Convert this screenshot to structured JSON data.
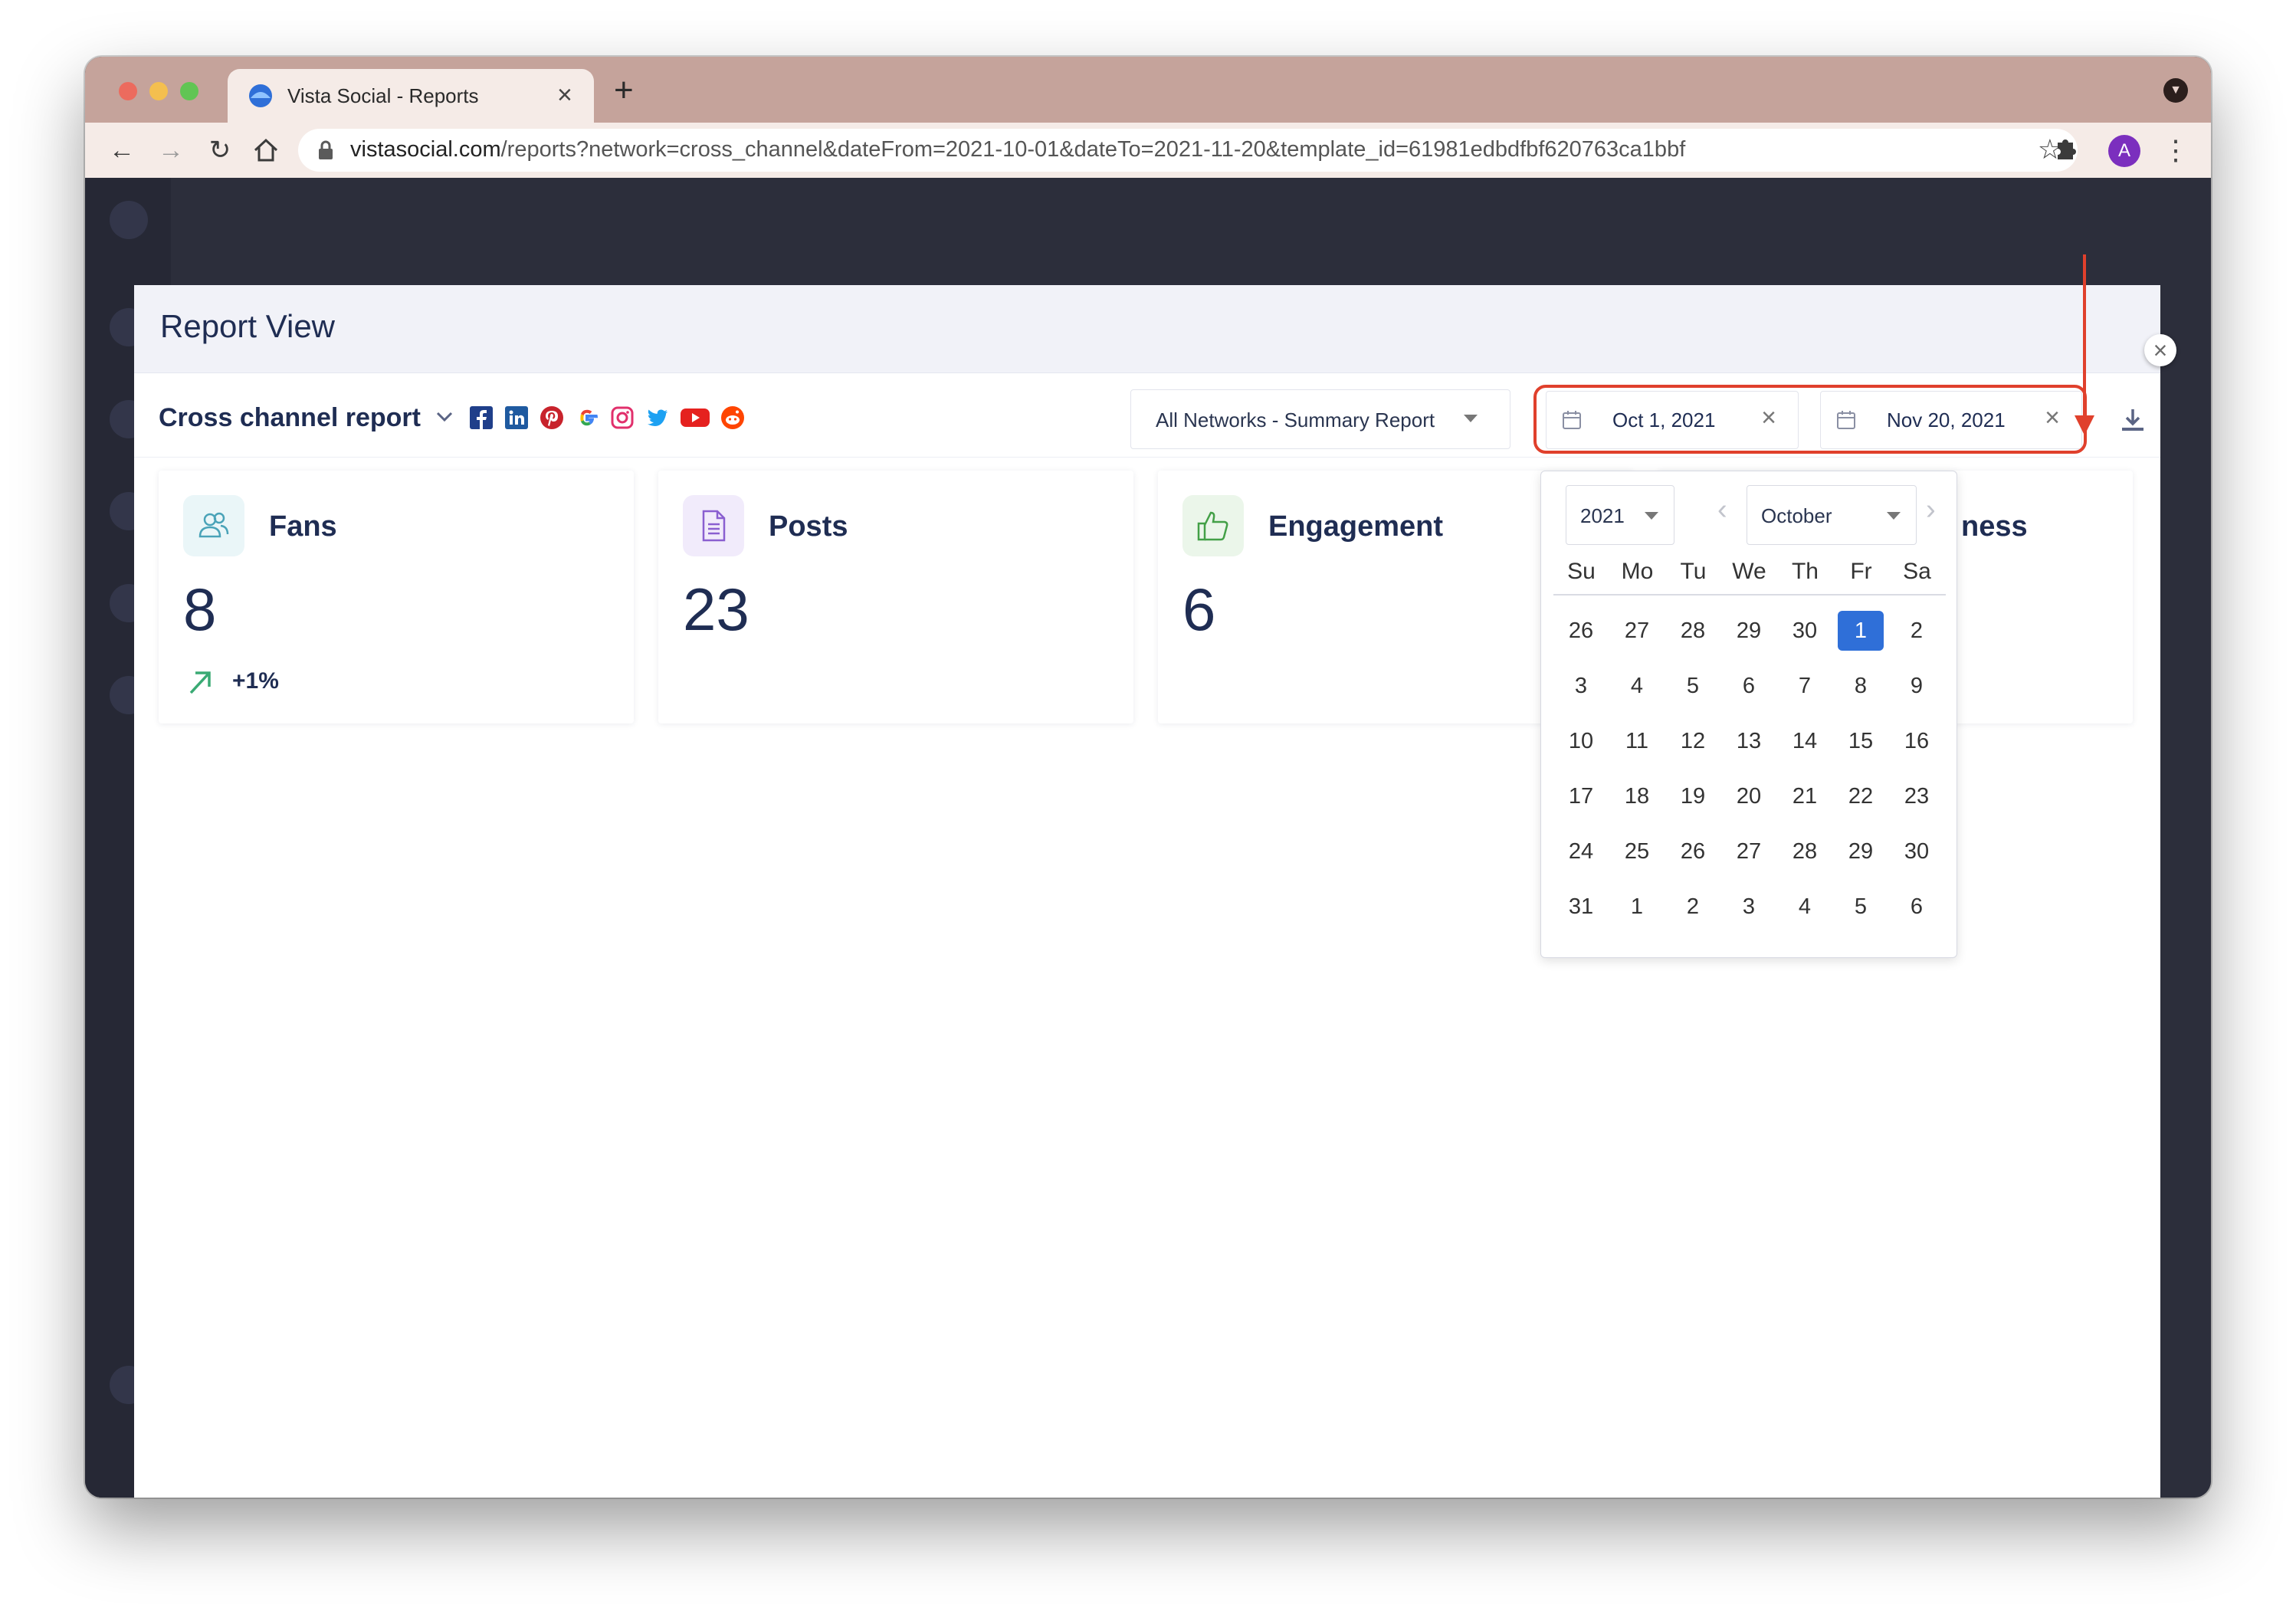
{
  "browser": {
    "tab_title": "Vista Social - Reports",
    "tab_close": "×",
    "new_tab": "+",
    "url_host": "vistasocial.com",
    "url_path": "/reports?network=cross_channel&dateFrom=2021-10-01&dateTo=2021-11-20&template_id=61981edbdfbf620763ca1bbf",
    "profile_initial": "A"
  },
  "modal": {
    "title": "Report View",
    "close": "×"
  },
  "report": {
    "name": "Cross channel report",
    "networks": [
      "facebook-icon",
      "linkedin-icon",
      "pinterest-icon",
      "google-icon",
      "instagram-icon",
      "twitter-icon",
      "youtube-icon",
      "reddit-icon"
    ],
    "network_select": "All Networks - Summary Report",
    "date_from": "Oct 1, 2021",
    "date_to": "Nov 20, 2021",
    "clear": "×"
  },
  "cards": [
    {
      "title": "Fans",
      "value": "8",
      "change": "+1%",
      "icon": "users-icon",
      "icon_color": "#4aa3b8"
    },
    {
      "title": "Posts",
      "value": "23",
      "icon": "document-icon",
      "icon_color": "#8a5fd0"
    },
    {
      "title": "Engagement",
      "value": "6",
      "icon": "thumbs-up-icon",
      "icon_color": "#43a047"
    },
    {
      "title_visible_fragment": "ness"
    }
  ],
  "calendar": {
    "year": "2021",
    "month": "October",
    "prev": "‹",
    "next": "›",
    "weekdays": [
      "Su",
      "Mo",
      "Tu",
      "We",
      "Th",
      "Fr",
      "Sa"
    ],
    "weeks": [
      [
        "26",
        "27",
        "28",
        "29",
        "30",
        "1",
        "2"
      ],
      [
        "3",
        "4",
        "5",
        "6",
        "7",
        "8",
        "9"
      ],
      [
        "10",
        "11",
        "12",
        "13",
        "14",
        "15",
        "16"
      ],
      [
        "17",
        "18",
        "19",
        "20",
        "21",
        "22",
        "23"
      ],
      [
        "24",
        "25",
        "26",
        "27",
        "28",
        "29",
        "30"
      ],
      [
        "31",
        "1",
        "2",
        "3",
        "4",
        "5",
        "6"
      ]
    ],
    "selected_day": "1"
  },
  "colors": {
    "brand_text": "#1f2d53",
    "selected_day": "#2f6fd8",
    "annotation": "#e0402c"
  }
}
